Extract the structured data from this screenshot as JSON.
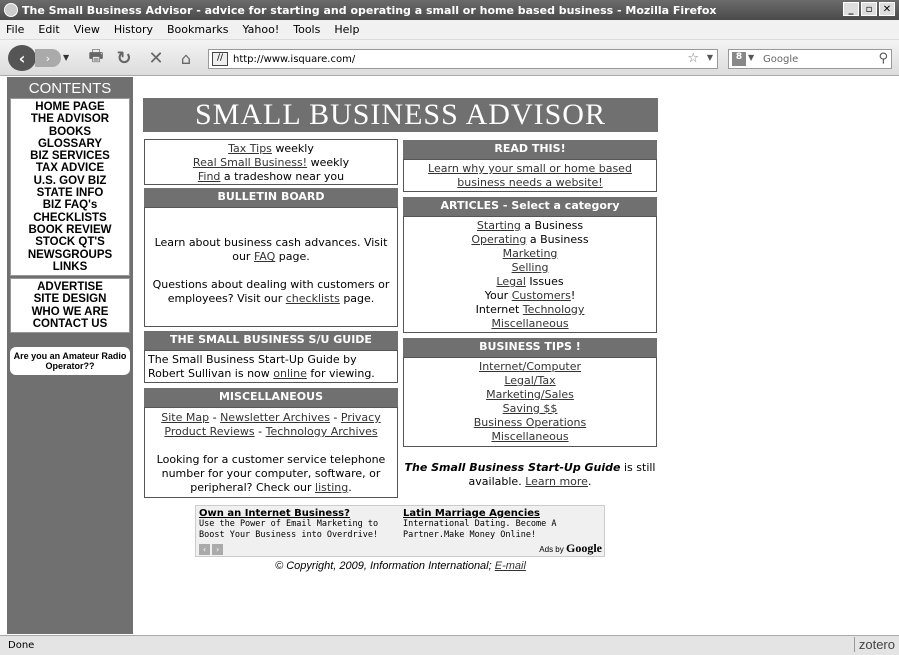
{
  "window": {
    "title": "The Small Business Advisor - advice for starting and operating a small or home based business - Mozilla Firefox"
  },
  "menu": [
    "File",
    "Edit",
    "View",
    "History",
    "Bookmarks",
    "Yahoo!",
    "Tools",
    "Help"
  ],
  "nav": {
    "url": "http://www.isquare.com/",
    "search_placeholder": "Google"
  },
  "sidebar": {
    "header": "CONTENTS",
    "group1": [
      "HOME PAGE",
      "THE ADVISOR",
      "BOOKS",
      "GLOSSARY",
      "BIZ SERVICES",
      "TAX ADVICE",
      "U.S. GOV BIZ",
      "STATE INFO",
      "BIZ FAQ's",
      "CHECKLISTS",
      "BOOK REVIEW",
      "STOCK QT'S",
      "NEWSGROUPS",
      "LINKS"
    ],
    "group2": [
      "ADVERTISE",
      "SITE DESIGN",
      "WHO WE ARE",
      "CONTACT US"
    ],
    "ham": "Are you an Amateur Radio Operator??"
  },
  "banner": "SMALL BUSINESS ADVISOR",
  "promo": {
    "l1_link": "Tax Tips",
    "l1_text": " weekly",
    "l2_link": "Real Small Business!",
    "l2_text": " weekly",
    "l3_link": "Find",
    "l3_text": " a tradeshow near you"
  },
  "bulletin": {
    "header": "BULLETIN BOARD",
    "p1_text": "Learn about business cash advances. Visit our ",
    "p1_link": "FAQ",
    "p1_end": " page.",
    "p2_text": "Questions about dealing with customers or employees? Visit our ",
    "p2_link": "checklists",
    "p2_end": " page."
  },
  "guide": {
    "header": "THE SMALL BUSINESS S/U GUIDE",
    "text": "The Small Business Start-Up Guide by Robert Sullivan is now ",
    "link": "online",
    "end": " for viewing."
  },
  "misc": {
    "header": "MISCELLANEOUS",
    "links_row1": [
      "Site Map",
      "Newsletter Archives",
      "Privacy"
    ],
    "links_row2": [
      "Product Reviews",
      "Technology Archives"
    ],
    "sep": " - ",
    "p_text": "Looking for a customer service telephone number for your computer, software, or peripheral? Check our ",
    "p_link": "listing",
    "p_end": "."
  },
  "readthis": {
    "header": "READ THIS!",
    "link": "Learn why your small or home based business needs a website!"
  },
  "articles": {
    "header": "ARTICLES - Select a category",
    "items": [
      {
        "link": "Starting",
        "after": " a Business",
        "before": ""
      },
      {
        "link": "Operating",
        "after": " a Business",
        "before": ""
      },
      {
        "link": "Marketing",
        "after": "",
        "before": ""
      },
      {
        "link": "Selling",
        "after": "",
        "before": ""
      },
      {
        "link": "Legal",
        "after": " Issues",
        "before": ""
      },
      {
        "link": "Customers",
        "after": "!",
        "before": "Your "
      },
      {
        "link": "Technology",
        "after": "",
        "before": "Internet "
      },
      {
        "link": "Miscellaneous",
        "after": "",
        "before": ""
      }
    ]
  },
  "tips": {
    "header": "BUSINESS TIPS !",
    "items": [
      "Internet/Computer",
      "Legal/Tax",
      "Marketing/Sales",
      "Saving $$",
      "Business Operations",
      "Miscellaneous"
    ]
  },
  "guide_note": {
    "title": "The Small Business Start-Up Guide",
    "text": " is still available. ",
    "link": "Learn more",
    "end": "."
  },
  "ads": {
    "ad1_title": "Own an Internet Business?",
    "ad1_text": "Use the Power of Email Marketing to Boost Your Business into Overdrive!",
    "ad2_title": "Latin Marriage Agencies",
    "ad2_text": "International Dating. Become A Partner.Make Money Online!",
    "adsby": "Ads by",
    "adsby_brand": "Google"
  },
  "footer": {
    "copyright": "© Copyright, 2009, Information International; ",
    "email": "E-mail"
  },
  "status": {
    "text": "Done",
    "zotero": "zotero"
  }
}
